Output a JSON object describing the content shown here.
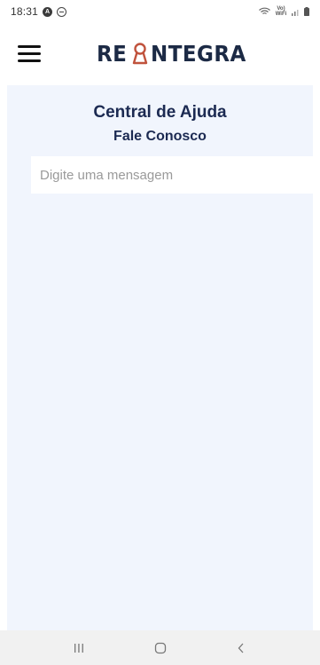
{
  "status_bar": {
    "time": "18:31",
    "notification_icons": [
      "a-badge-icon",
      "do-not-disturb-icon"
    ],
    "network_label": "Vo) WiFi"
  },
  "app_bar": {
    "brand": {
      "left": "RE",
      "right": "NTEGRA"
    },
    "menu_icon": "hamburger-menu-icon"
  },
  "page": {
    "title": "Central de Ajuda",
    "subtitle": "Fale Conosco",
    "message_input": {
      "value": "",
      "placeholder": "Digite uma mensagem"
    }
  },
  "nav_bar": {
    "icons": [
      "recent-apps-icon",
      "home-icon",
      "back-icon"
    ]
  },
  "colors": {
    "brand_navy": "#1c2a45",
    "brand_accent": "#c0533d",
    "content_background": "#f1f5fd",
    "heading_text": "#1c2a52"
  }
}
